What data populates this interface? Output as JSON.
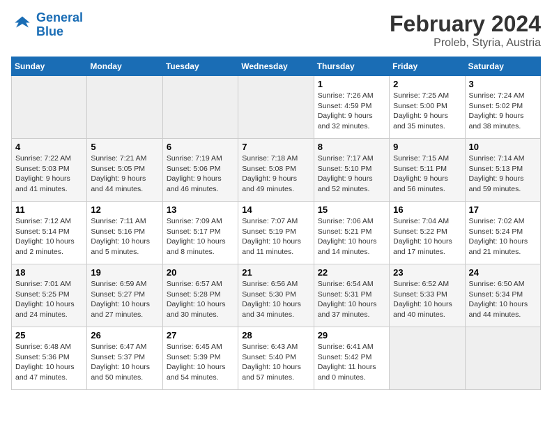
{
  "header": {
    "logo_general": "General",
    "logo_blue": "Blue",
    "title": "February 2024",
    "subtitle": "Proleb, Styria, Austria"
  },
  "weekdays": [
    "Sunday",
    "Monday",
    "Tuesday",
    "Wednesday",
    "Thursday",
    "Friday",
    "Saturday"
  ],
  "weeks": [
    [
      {
        "day": "",
        "info": ""
      },
      {
        "day": "",
        "info": ""
      },
      {
        "day": "",
        "info": ""
      },
      {
        "day": "",
        "info": ""
      },
      {
        "day": "1",
        "info": "Sunrise: 7:26 AM\nSunset: 4:59 PM\nDaylight: 9 hours\nand 32 minutes."
      },
      {
        "day": "2",
        "info": "Sunrise: 7:25 AM\nSunset: 5:00 PM\nDaylight: 9 hours\nand 35 minutes."
      },
      {
        "day": "3",
        "info": "Sunrise: 7:24 AM\nSunset: 5:02 PM\nDaylight: 9 hours\nand 38 minutes."
      }
    ],
    [
      {
        "day": "4",
        "info": "Sunrise: 7:22 AM\nSunset: 5:03 PM\nDaylight: 9 hours\nand 41 minutes."
      },
      {
        "day": "5",
        "info": "Sunrise: 7:21 AM\nSunset: 5:05 PM\nDaylight: 9 hours\nand 44 minutes."
      },
      {
        "day": "6",
        "info": "Sunrise: 7:19 AM\nSunset: 5:06 PM\nDaylight: 9 hours\nand 46 minutes."
      },
      {
        "day": "7",
        "info": "Sunrise: 7:18 AM\nSunset: 5:08 PM\nDaylight: 9 hours\nand 49 minutes."
      },
      {
        "day": "8",
        "info": "Sunrise: 7:17 AM\nSunset: 5:10 PM\nDaylight: 9 hours\nand 52 minutes."
      },
      {
        "day": "9",
        "info": "Sunrise: 7:15 AM\nSunset: 5:11 PM\nDaylight: 9 hours\nand 56 minutes."
      },
      {
        "day": "10",
        "info": "Sunrise: 7:14 AM\nSunset: 5:13 PM\nDaylight: 9 hours\nand 59 minutes."
      }
    ],
    [
      {
        "day": "11",
        "info": "Sunrise: 7:12 AM\nSunset: 5:14 PM\nDaylight: 10 hours\nand 2 minutes."
      },
      {
        "day": "12",
        "info": "Sunrise: 7:11 AM\nSunset: 5:16 PM\nDaylight: 10 hours\nand 5 minutes."
      },
      {
        "day": "13",
        "info": "Sunrise: 7:09 AM\nSunset: 5:17 PM\nDaylight: 10 hours\nand 8 minutes."
      },
      {
        "day": "14",
        "info": "Sunrise: 7:07 AM\nSunset: 5:19 PM\nDaylight: 10 hours\nand 11 minutes."
      },
      {
        "day": "15",
        "info": "Sunrise: 7:06 AM\nSunset: 5:21 PM\nDaylight: 10 hours\nand 14 minutes."
      },
      {
        "day": "16",
        "info": "Sunrise: 7:04 AM\nSunset: 5:22 PM\nDaylight: 10 hours\nand 17 minutes."
      },
      {
        "day": "17",
        "info": "Sunrise: 7:02 AM\nSunset: 5:24 PM\nDaylight: 10 hours\nand 21 minutes."
      }
    ],
    [
      {
        "day": "18",
        "info": "Sunrise: 7:01 AM\nSunset: 5:25 PM\nDaylight: 10 hours\nand 24 minutes."
      },
      {
        "day": "19",
        "info": "Sunrise: 6:59 AM\nSunset: 5:27 PM\nDaylight: 10 hours\nand 27 minutes."
      },
      {
        "day": "20",
        "info": "Sunrise: 6:57 AM\nSunset: 5:28 PM\nDaylight: 10 hours\nand 30 minutes."
      },
      {
        "day": "21",
        "info": "Sunrise: 6:56 AM\nSunset: 5:30 PM\nDaylight: 10 hours\nand 34 minutes."
      },
      {
        "day": "22",
        "info": "Sunrise: 6:54 AM\nSunset: 5:31 PM\nDaylight: 10 hours\nand 37 minutes."
      },
      {
        "day": "23",
        "info": "Sunrise: 6:52 AM\nSunset: 5:33 PM\nDaylight: 10 hours\nand 40 minutes."
      },
      {
        "day": "24",
        "info": "Sunrise: 6:50 AM\nSunset: 5:34 PM\nDaylight: 10 hours\nand 44 minutes."
      }
    ],
    [
      {
        "day": "25",
        "info": "Sunrise: 6:48 AM\nSunset: 5:36 PM\nDaylight: 10 hours\nand 47 minutes."
      },
      {
        "day": "26",
        "info": "Sunrise: 6:47 AM\nSunset: 5:37 PM\nDaylight: 10 hours\nand 50 minutes."
      },
      {
        "day": "27",
        "info": "Sunrise: 6:45 AM\nSunset: 5:39 PM\nDaylight: 10 hours\nand 54 minutes."
      },
      {
        "day": "28",
        "info": "Sunrise: 6:43 AM\nSunset: 5:40 PM\nDaylight: 10 hours\nand 57 minutes."
      },
      {
        "day": "29",
        "info": "Sunrise: 6:41 AM\nSunset: 5:42 PM\nDaylight: 11 hours\nand 0 minutes."
      },
      {
        "day": "",
        "info": ""
      },
      {
        "day": "",
        "info": ""
      }
    ]
  ]
}
